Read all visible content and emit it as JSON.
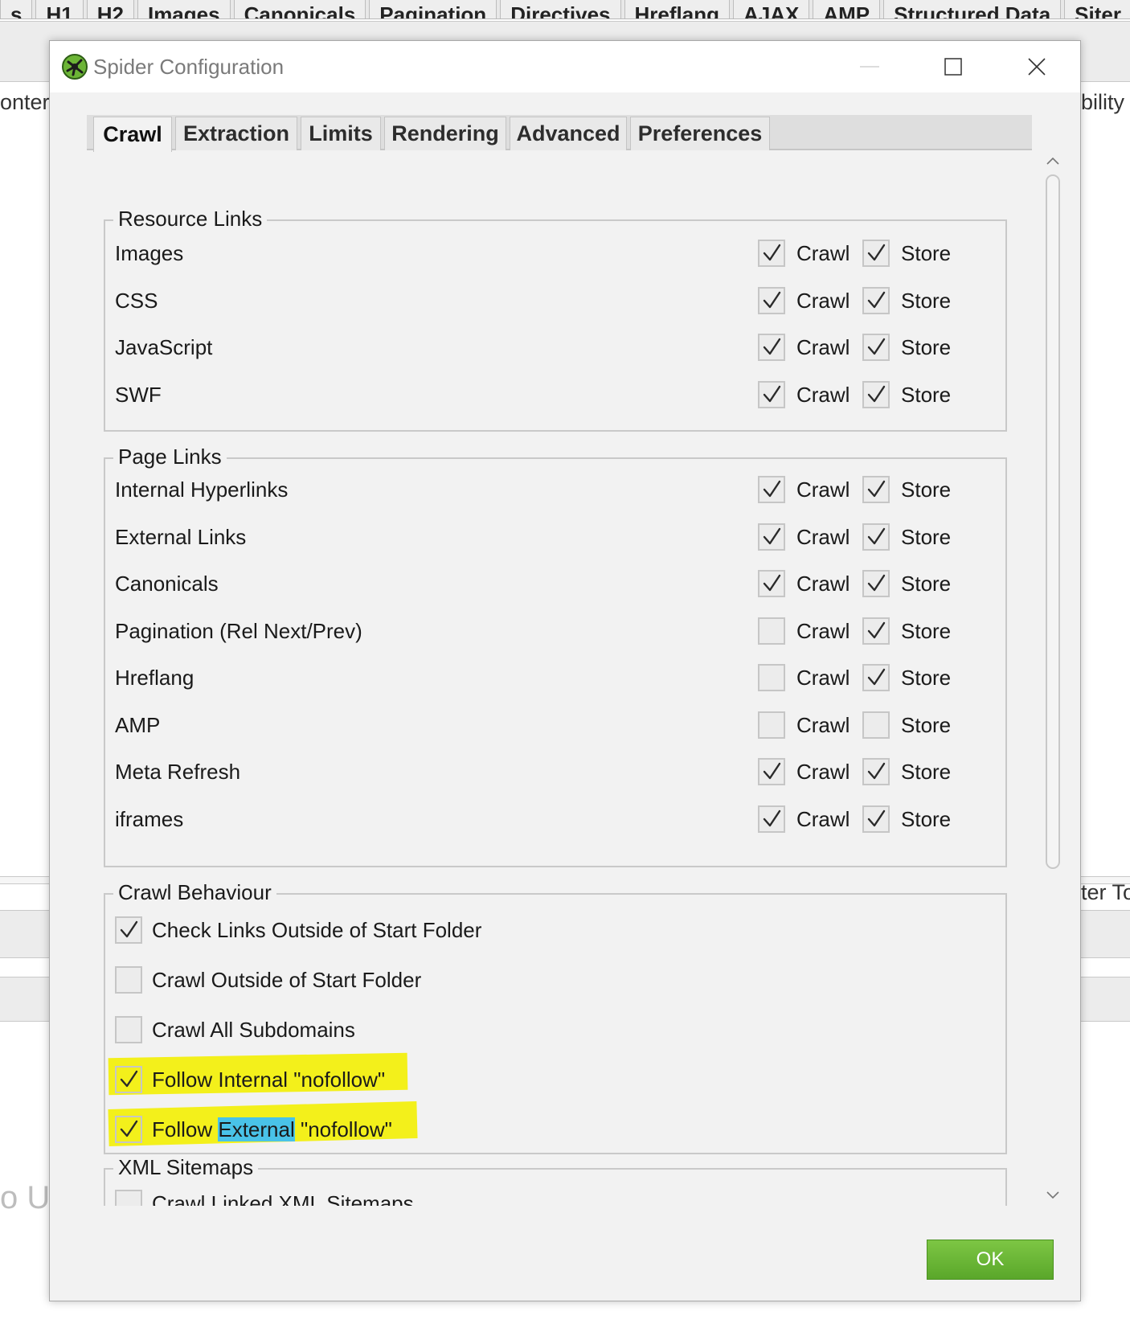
{
  "background_app": {
    "tabs": [
      "s",
      "H1",
      "H2",
      "Images",
      "Canonicals",
      "Pagination",
      "Directives",
      "Hreflang",
      "AJAX",
      "AMP",
      "Structured Data",
      "Siter"
    ],
    "left_fragments": [
      "onter",
      "o U"
    ],
    "right_fragments": [
      "bility",
      "ter To"
    ]
  },
  "dialog": {
    "title": "Spider Configuration",
    "icon": "spider-logo-icon",
    "tabs": [
      {
        "label": "Crawl",
        "active": true
      },
      {
        "label": "Extraction",
        "active": false
      },
      {
        "label": "Limits",
        "active": false
      },
      {
        "label": "Rendering",
        "active": false
      },
      {
        "label": "Advanced",
        "active": false
      },
      {
        "label": "Preferences",
        "active": false
      }
    ],
    "crawl_text": "Crawl",
    "store_text": "Store",
    "resource_links": {
      "legend": "Resource Links",
      "rows": [
        {
          "label": "Images",
          "crawl": true,
          "store": true
        },
        {
          "label": "CSS",
          "crawl": true,
          "store": true
        },
        {
          "label": "JavaScript",
          "crawl": true,
          "store": true
        },
        {
          "label": "SWF",
          "crawl": true,
          "store": true
        }
      ]
    },
    "page_links": {
      "legend": "Page Links",
      "rows": [
        {
          "label": "Internal Hyperlinks",
          "crawl": true,
          "store": true
        },
        {
          "label": "External Links",
          "crawl": true,
          "store": true
        },
        {
          "label": "Canonicals",
          "crawl": true,
          "store": true
        },
        {
          "label": "Pagination (Rel Next/Prev)",
          "crawl": false,
          "store": true
        },
        {
          "label": "Hreflang",
          "crawl": false,
          "store": true
        },
        {
          "label": "AMP",
          "crawl": false,
          "store": false
        },
        {
          "label": "Meta Refresh",
          "crawl": true,
          "store": true
        },
        {
          "label": "iframes",
          "crawl": true,
          "store": true
        }
      ]
    },
    "crawl_behaviour": {
      "legend": "Crawl Behaviour",
      "rows": [
        {
          "label": "Check Links Outside of Start Folder",
          "checked": true
        },
        {
          "label": "Crawl Outside of Start Folder",
          "checked": false
        },
        {
          "label": "Crawl All Subdomains",
          "checked": false
        }
      ],
      "follow_internal": {
        "text": "Follow Internal \"nofollow\"",
        "checked": true
      },
      "follow_external": {
        "part1": "Follow ",
        "part2": "External",
        "part3": " \"nofollow\"",
        "checked": true
      }
    },
    "xml_sitemaps": {
      "legend": "XML Sitemaps",
      "rows": [
        {
          "label": "Crawl Linked XML Sitemaps",
          "checked": false
        }
      ]
    },
    "ok_label": "OK",
    "highlight_colors": {
      "yellow": "#f3f01b",
      "blue": "#49c3e8"
    },
    "accent_green": "#6cb536"
  }
}
